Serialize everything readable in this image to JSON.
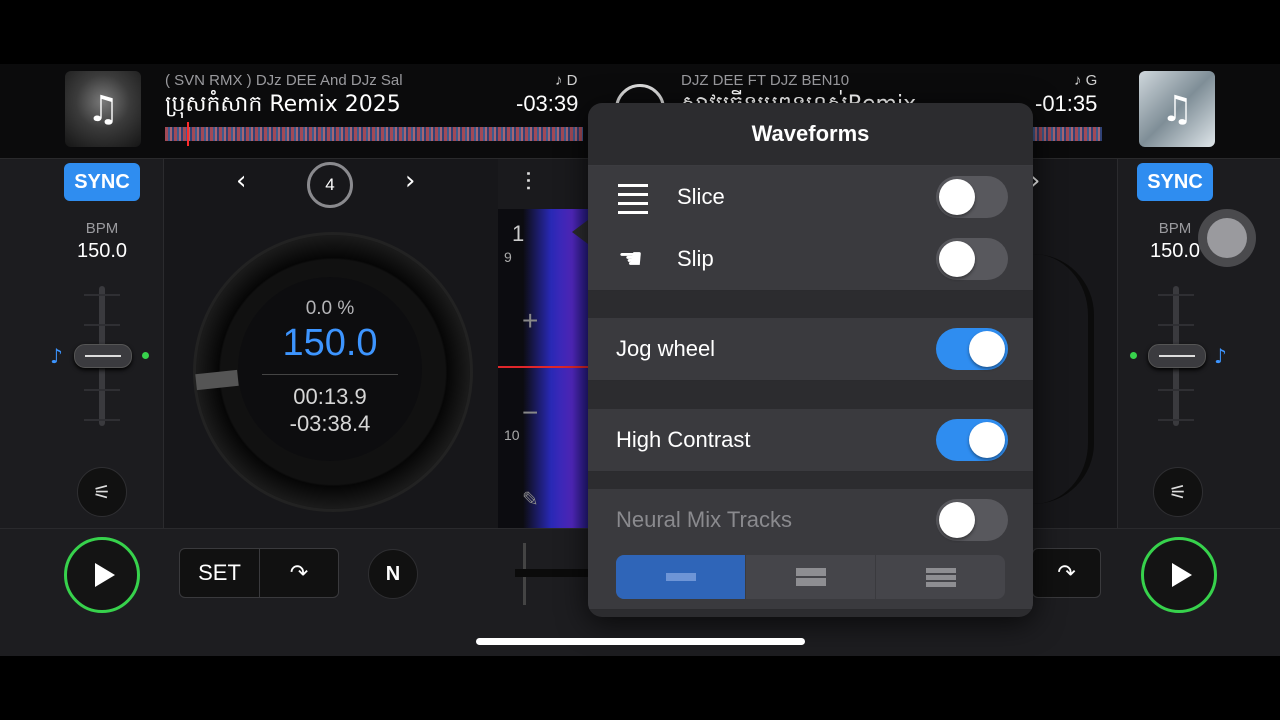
{
  "left_deck": {
    "artist": "( SVN RMX ) DJz DEE And  DJz Sal",
    "title": "ប្រុសកំសាក Remix 2025",
    "key": "♪ D",
    "remaining": "-03:39",
    "sync_label": "SYNC",
    "bpm_label": "BPM",
    "bpm_value": "150.0",
    "jog_pitch": "0.0 %",
    "jog_bpm": "150.0",
    "elapsed": "00:13.9",
    "time_left": "-03:38.4",
    "loop_size": "4",
    "set_label": "SET"
  },
  "right_deck": {
    "artist": "DJZ DEE FT DJZ BEN10",
    "title": "ស្ទាវច្រើនប្រពន្ធហស់Remix",
    "key": "♪ G",
    "remaining": "-01:35",
    "sync_label": "SYNC",
    "bpm_label": "BPM",
    "bpm_value": "150.0"
  },
  "center": {
    "beat_marker": "1",
    "grid_top": "9",
    "grid_bottom": "10",
    "plus": "+",
    "minus": "−"
  },
  "popup": {
    "title": "Waveforms",
    "rows": [
      {
        "label": "Slice",
        "on": false
      },
      {
        "label": "Slip",
        "on": false
      },
      {
        "label": "Jog wheel",
        "on": true
      },
      {
        "label": "High Contrast",
        "on": true
      },
      {
        "label": "Neural Mix Tracks",
        "on": false
      }
    ]
  },
  "colors": {
    "accent_blue": "#2f8df0",
    "play_green": "#37d24c",
    "bpm_blue": "#3d95ff"
  }
}
